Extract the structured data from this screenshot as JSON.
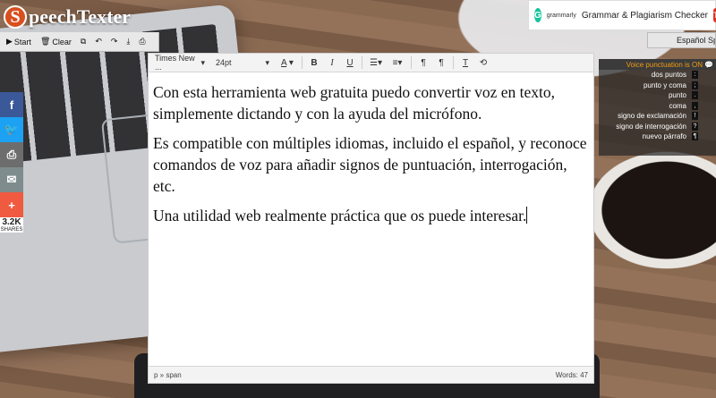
{
  "app": {
    "logo_letter": "S",
    "logo_text": "peechTexter"
  },
  "toolbar": {
    "start": "Start",
    "clear": "Clear",
    "icons": [
      "copy-icon",
      "undo-icon",
      "redo-icon",
      "download-icon",
      "print-icon"
    ]
  },
  "ad": {
    "brand": "grammarly",
    "text": "Grammar & Plagiarism Checker",
    "cta": "Tr"
  },
  "language": {
    "selected": "Español Spain"
  },
  "share": {
    "count": "3.2K",
    "label": "SHARES",
    "colors": {
      "facebook": "#3b5998",
      "twitter": "#1da1f2",
      "print": "#6d6d6d",
      "email": "#7f8c8d",
      "more": "#f05a40"
    }
  },
  "editor": {
    "font_family_value": "Times New ...",
    "font_size_value": "24pt",
    "paragraphs": [
      "Con esta herramienta web gratuita puedo convertir voz en texto, simplemente dictando y con la ayuda del micrófono.",
      "Es compatible con múltiples idiomas, incluido el español, y reconoce comandos de voz para añadir signos de puntuación, interrogación, etc.",
      "Una utilidad web realmente práctica que os puede interesar."
    ],
    "path": "p » span",
    "word_count": "Words: 47"
  },
  "voice_punctuation": {
    "header": "Voice punctuation is ON",
    "items": [
      {
        "name": "dos puntos",
        "symbol": ":"
      },
      {
        "name": "punto y coma",
        "symbol": ";"
      },
      {
        "name": "punto",
        "symbol": "."
      },
      {
        "name": "coma",
        "symbol": ","
      },
      {
        "name": "signo de exclamación",
        "symbol": "!"
      },
      {
        "name": "signo de interrogación",
        "symbol": "?"
      },
      {
        "name": "nuevo párrafo",
        "symbol": "¶"
      }
    ]
  }
}
